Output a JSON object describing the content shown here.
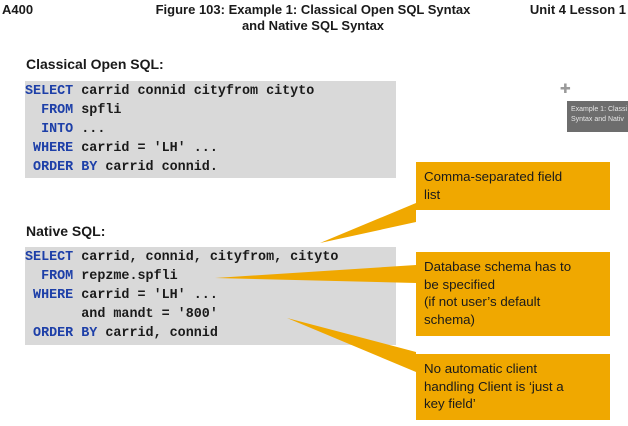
{
  "header": {
    "left": "A400",
    "center_line1": "Figure 103: Example 1: Classical Open SQL Syntax",
    "center_line2": "and Native SQL Syntax",
    "right": "Unit 4 Lesson 1"
  },
  "classical": {
    "title": "Classical Open SQL:",
    "lines": [
      {
        "kw": "SELECT",
        "rest": " carrid connid cityfrom cityto"
      },
      {
        "kw": "  FROM",
        "rest": " spfli"
      },
      {
        "kw": "  INTO",
        "rest": " ..."
      },
      {
        "kw": " WHERE",
        "rest": " carrid = 'LH' ..."
      },
      {
        "kw": " ORDER BY",
        "rest": " carrid connid."
      }
    ]
  },
  "native": {
    "title": "Native SQL:",
    "lines": [
      {
        "kw": "SELECT",
        "rest": " carrid, connid, cityfrom, cityto"
      },
      {
        "kw": "  FROM",
        "rest": " repzme.spfli"
      },
      {
        "kw": " WHERE",
        "rest": " carrid = 'LH' ..."
      },
      {
        "kw": "",
        "rest": "       and mandt = '800'"
      },
      {
        "kw": " ORDER BY",
        "rest": " carrid, connid"
      }
    ]
  },
  "callouts": {
    "c1_line1": "Comma-separated field",
    "c1_line2": "list",
    "c2_line1": "Database schema has to",
    "c2_line2": "be specified",
    "c2_line3": "(if not user’s default",
    "c2_line4": "schema)",
    "c3_line1": "No automatic client",
    "c3_line2": "handling Client is ‘just a",
    "c3_line3": "key field’"
  },
  "tooltip": {
    "line1": "Example 1: Classi",
    "line2": "Syntax and Nativ"
  },
  "colors": {
    "keyword": "#1d3fa8",
    "code_bg": "#d9d9d9",
    "callout": "#f0a800"
  }
}
